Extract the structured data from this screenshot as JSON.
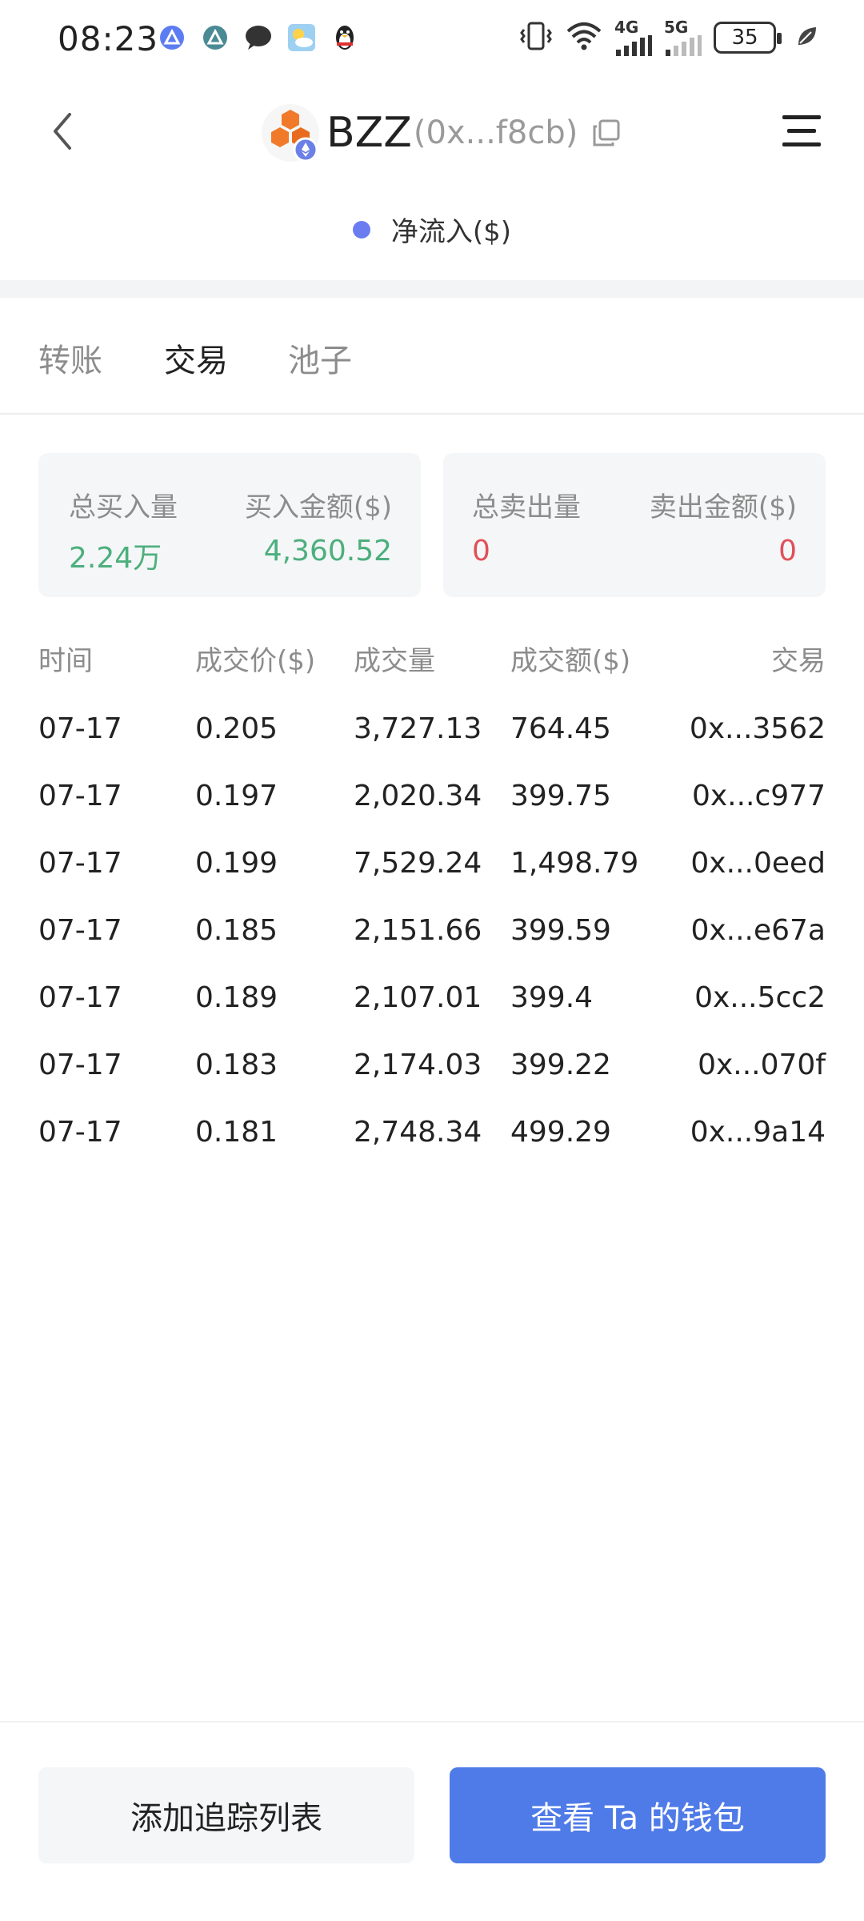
{
  "status_bar": {
    "time": "08:23",
    "notification_icons": [
      "triangle-app-icon",
      "triangle-app-icon-2",
      "chat-bubble-icon",
      "weather-icon",
      "qq-penguin-icon"
    ],
    "signal_4g_label": "4G",
    "signal_5g_label": "5G",
    "battery": "35"
  },
  "header": {
    "token_symbol": "BZZ",
    "token_address": "(0x...f8cb)"
  },
  "legend": {
    "label": "净流入($)",
    "color": "#6a7cf0"
  },
  "tabs": [
    {
      "label": "转账",
      "active": false
    },
    {
      "label": "交易",
      "active": true
    },
    {
      "label": "池子",
      "active": false
    }
  ],
  "summary": {
    "buy": {
      "total_label": "总买入量",
      "total_value": "2.24万",
      "amount_label": "买入金额($)",
      "amount_value": "4,360.52"
    },
    "sell": {
      "total_label": "总卖出量",
      "total_value": "0",
      "amount_label": "卖出金额($)",
      "amount_value": "0"
    }
  },
  "table": {
    "headers": [
      "时间",
      "成交价($)",
      "成交量",
      "成交额($)",
      "交易"
    ],
    "rows": [
      {
        "time": "07-17",
        "price": "0.205",
        "volume": "3,727.13",
        "amount": "764.45",
        "tx": "0x...3562"
      },
      {
        "time": "07-17",
        "price": "0.197",
        "volume": "2,020.34",
        "amount": "399.75",
        "tx": "0x...c977"
      },
      {
        "time": "07-17",
        "price": "0.199",
        "volume": "7,529.24",
        "amount": "1,498.79",
        "tx": "0x...0eed"
      },
      {
        "time": "07-17",
        "price": "0.185",
        "volume": "2,151.66",
        "amount": "399.59",
        "tx": "0x...e67a"
      },
      {
        "time": "07-17",
        "price": "0.189",
        "volume": "2,107.01",
        "amount": "399.4",
        "tx": "0x...5cc2"
      },
      {
        "time": "07-17",
        "price": "0.183",
        "volume": "2,174.03",
        "amount": "399.22",
        "tx": "0x...070f"
      },
      {
        "time": "07-17",
        "price": "0.181",
        "volume": "2,748.34",
        "amount": "499.29",
        "tx": "0x...9a14"
      }
    ]
  },
  "buttons": {
    "add_watchlist": "添加追踪列表",
    "view_wallet": "查看 Ta 的钱包"
  },
  "colors": {
    "green": "#4caf7d",
    "red": "#e0505a",
    "primary": "#4f7be8",
    "token_orange": "#f07a2a"
  }
}
